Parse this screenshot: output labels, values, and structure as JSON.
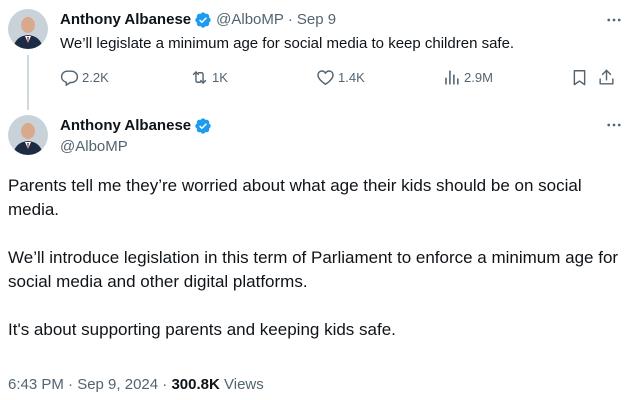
{
  "reply_tweet": {
    "author_name": "Anthony Albanese",
    "handle": "@AlboMP",
    "date": "Sep 9",
    "text": "We’ll legislate a minimum age for social media to keep children safe.",
    "counts": {
      "replies": "2.2K",
      "reposts": "1K",
      "likes": "1.4K",
      "views": "2.9M"
    }
  },
  "main_tweet": {
    "author_name": "Anthony Albanese",
    "handle": "@AlboMP",
    "paragraphs": [
      "Parents tell me they’re worried about what age their kids should be on social media.",
      "We’ll introduce legislation in this term of Parliament to enforce a minimum age for social media and other digital platforms.",
      "It's about supporting parents and keeping kids safe."
    ],
    "timestamp": "6:43 PM · Sep 9, 2024",
    "separator": "·",
    "views_count": "300.8K",
    "views_label": "Views"
  },
  "icons": {
    "verified": "verified-badge-icon",
    "more": "more-options-icon",
    "reply": "reply-icon",
    "repost": "repost-icon",
    "like": "like-icon",
    "views": "views-icon",
    "bookmark": "bookmark-icon",
    "share": "share-icon"
  },
  "colors": {
    "text": "#0f1419",
    "muted": "#536471",
    "verified_blue": "#1d9bf0",
    "thread_line": "#cfd9de"
  }
}
